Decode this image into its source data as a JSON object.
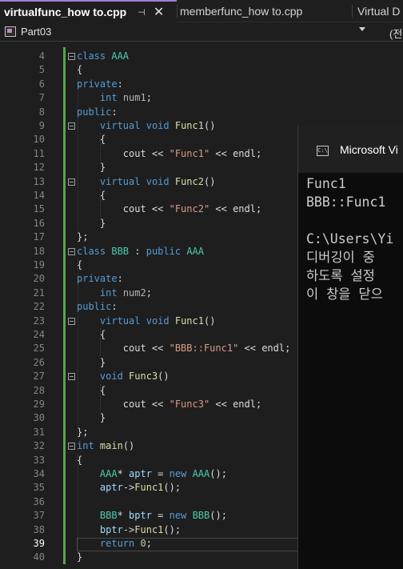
{
  "tabs": [
    {
      "label": "virtualfunc_how to.cpp",
      "active": true,
      "pin_icon": "pin-icon",
      "close_icon": "close-icon"
    },
    {
      "label": "memberfunc_how to.cpp",
      "active": false
    },
    {
      "label": "Virtual D",
      "active": false
    }
  ],
  "navbar": {
    "project": "Part03",
    "scope_partial": "(전"
  },
  "editor": {
    "line_numbers": [
      "4",
      "5",
      "6",
      "7",
      "8",
      "9",
      "10",
      "11",
      "12",
      "13",
      "14",
      "15",
      "16",
      "17",
      "18",
      "19",
      "20",
      "21",
      "22",
      "23",
      "24",
      "25",
      "26",
      "27",
      "28",
      "29",
      "30",
      "31",
      "32",
      "33",
      "34",
      "35",
      "36",
      "37",
      "38",
      "39",
      "40"
    ],
    "current_line": "39",
    "lines": [
      "class AAA",
      "{",
      "private:",
      "    int num1;",
      "public:",
      "    virtual void Func1()",
      "    {",
      "        cout << \"Func1\" << endl;",
      "    }",
      "    virtual void Func2()",
      "    {",
      "        cout << \"Func2\" << endl;",
      "    }",
      "};",
      "class BBB : public AAA",
      "{",
      "private:",
      "    int num2;",
      "public:",
      "    virtual void Func1()",
      "    {",
      "        cout << \"BBB::Func1\" << endl;",
      "    }",
      "    void Func3()",
      "    {",
      "        cout << \"Func3\" << endl;",
      "    }",
      "};",
      "int main()",
      "{",
      "    AAA* aptr = new AAA();",
      "    aptr->Func1();",
      "",
      "    BBB* bptr = new BBB();",
      "    bptr->Func1();",
      "    return 0;",
      "}"
    ]
  },
  "console": {
    "title": "Microsoft Vi",
    "icon": "console-icon",
    "output": [
      "Func1",
      "BBB::Func1",
      "",
      "C:\\Users\\Yi",
      "디버깅이 중",
      "하도록 설정",
      "이 창을 닫으"
    ]
  },
  "colors": {
    "keyword": "#569cd6",
    "type": "#4ec9b0",
    "function": "#dcdcaa",
    "string": "#d69d85",
    "number": "#b5cea8",
    "variable": "#9cdcfe",
    "change_bar": "#57a64a",
    "active_tab_accent": "#9b7ed6"
  }
}
